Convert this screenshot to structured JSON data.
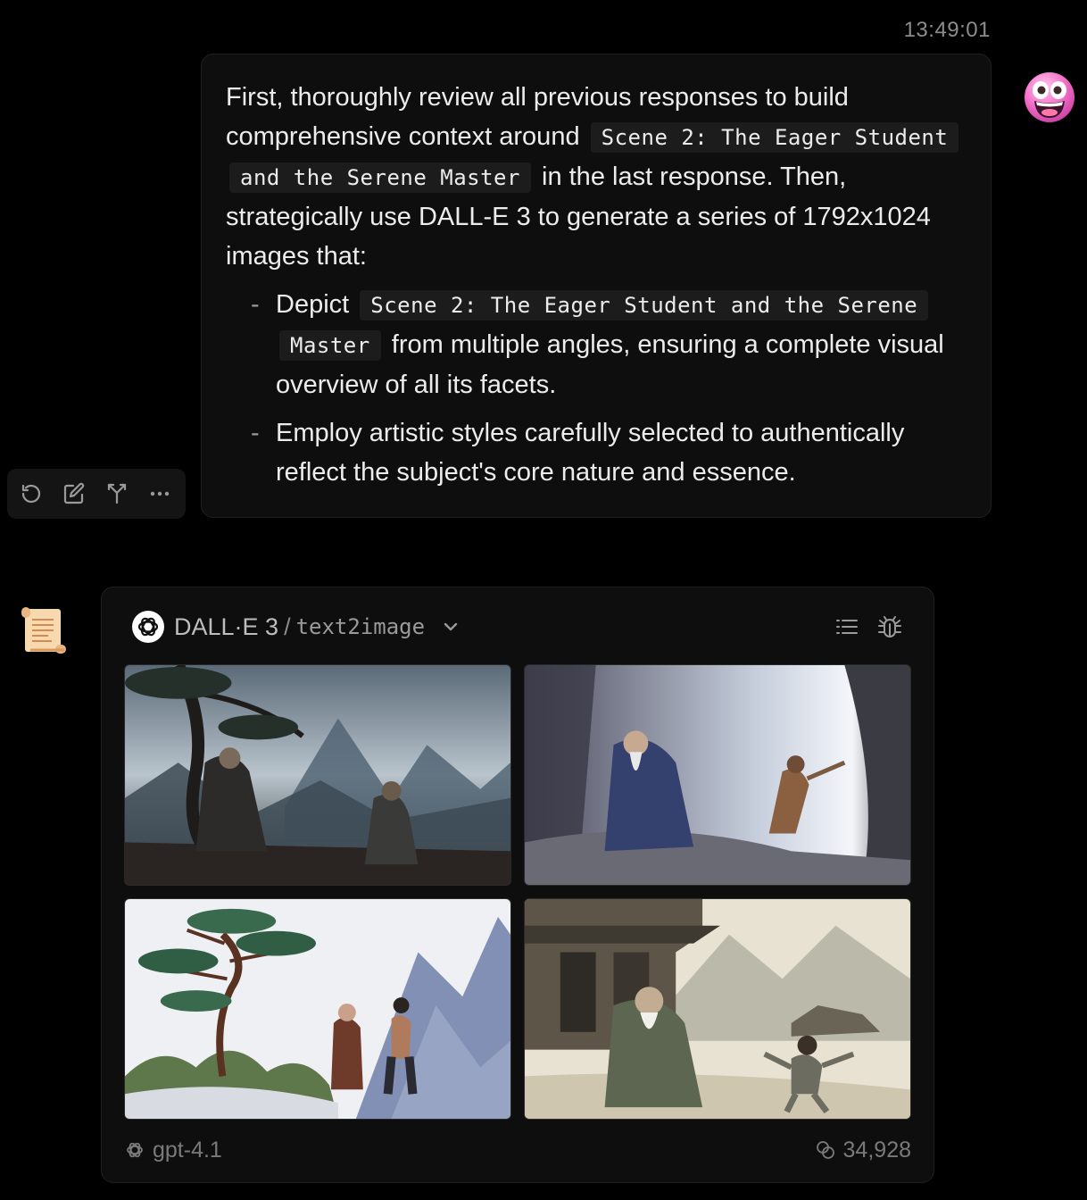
{
  "message": {
    "timestamp": "13:49:01",
    "paragraph": {
      "text_before": "First, thoroughly review all previous responses to build comprehensive context around",
      "code": "Scene 2: The Eager Student and the Serene Master",
      "text_after": "in the last response. Then, strategically use DALL-E 3 to generate a series of 1792x1024 images that:"
    },
    "bullets": [
      {
        "before": "Depict",
        "code": "Scene 2: The Eager Student and the Serene Master",
        "after": "from multiple angles, ensuring a complete visual overview of all its facets."
      },
      {
        "before": "Employ artistic styles carefully selected to authentically reflect the subject's core nature and essence.",
        "code": "",
        "after": ""
      }
    ],
    "actions": [
      "refresh-icon",
      "edit-icon",
      "branch-icon",
      "more-icon"
    ]
  },
  "response": {
    "model": "DALL·E 3",
    "separator": "/",
    "mode": "text2image",
    "header_icons": [
      "list-icon",
      "bug-icon"
    ],
    "images": [
      {
        "name": "ink-painting-master-student-pine"
      },
      {
        "name": "master-student-cave-light"
      },
      {
        "name": "watercolor-pine-mountain-duo"
      },
      {
        "name": "sepia-temple-martial-student"
      }
    ],
    "footer": {
      "model": "gpt-4.1",
      "tokens": "34,928"
    }
  },
  "colors": {
    "background": "#000000",
    "bubble": "#0e0e0e",
    "code_bg": "#1c1c1c",
    "muted": "#8c8c8c"
  }
}
